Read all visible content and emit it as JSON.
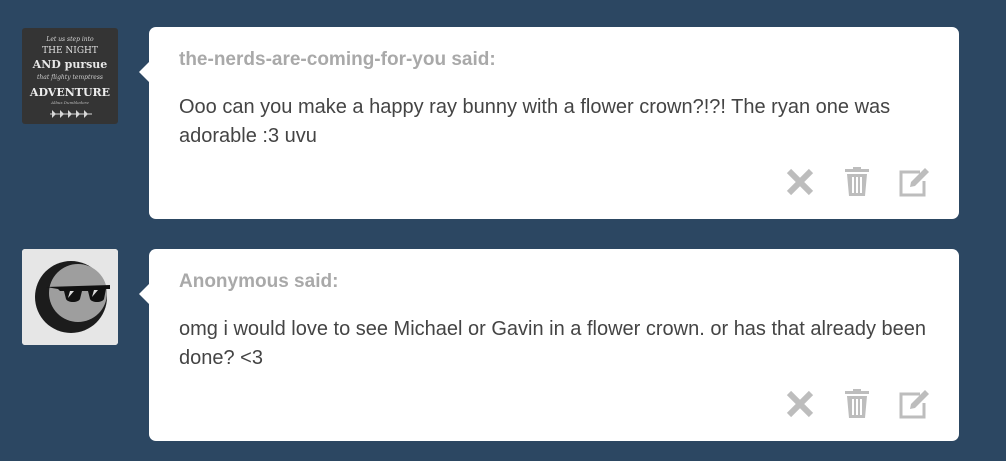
{
  "asks": [
    {
      "asker": "the-nerds-are-coming-for-you said:",
      "question": "Ooo can you make a happy ray bunny with a flower crown?!?! The ryan one was adorable :3 uvu",
      "avatar": {
        "kind": "chalkboard-quote",
        "lines": [
          "Let us step into",
          "THE NIGHT",
          "AND pursue",
          "that flighty temptress",
          "ADVENTURE",
          "Albus Dumbledore"
        ]
      }
    },
    {
      "asker": "Anonymous said:",
      "question": "omg i would love to see Michael or Gavin in a flower crown. or has that already been done? <3",
      "avatar": {
        "kind": "anonymous-sunglasses"
      }
    }
  ],
  "actions": {
    "ignore_icon": "x-icon",
    "delete_icon": "trash-icon",
    "answer_icon": "edit-icon"
  },
  "colors": {
    "background": "#2c4762",
    "bubble": "#ffffff",
    "asker_text": "#a9a9a9",
    "question_text": "#444444",
    "icon": "#bdbdbd"
  }
}
